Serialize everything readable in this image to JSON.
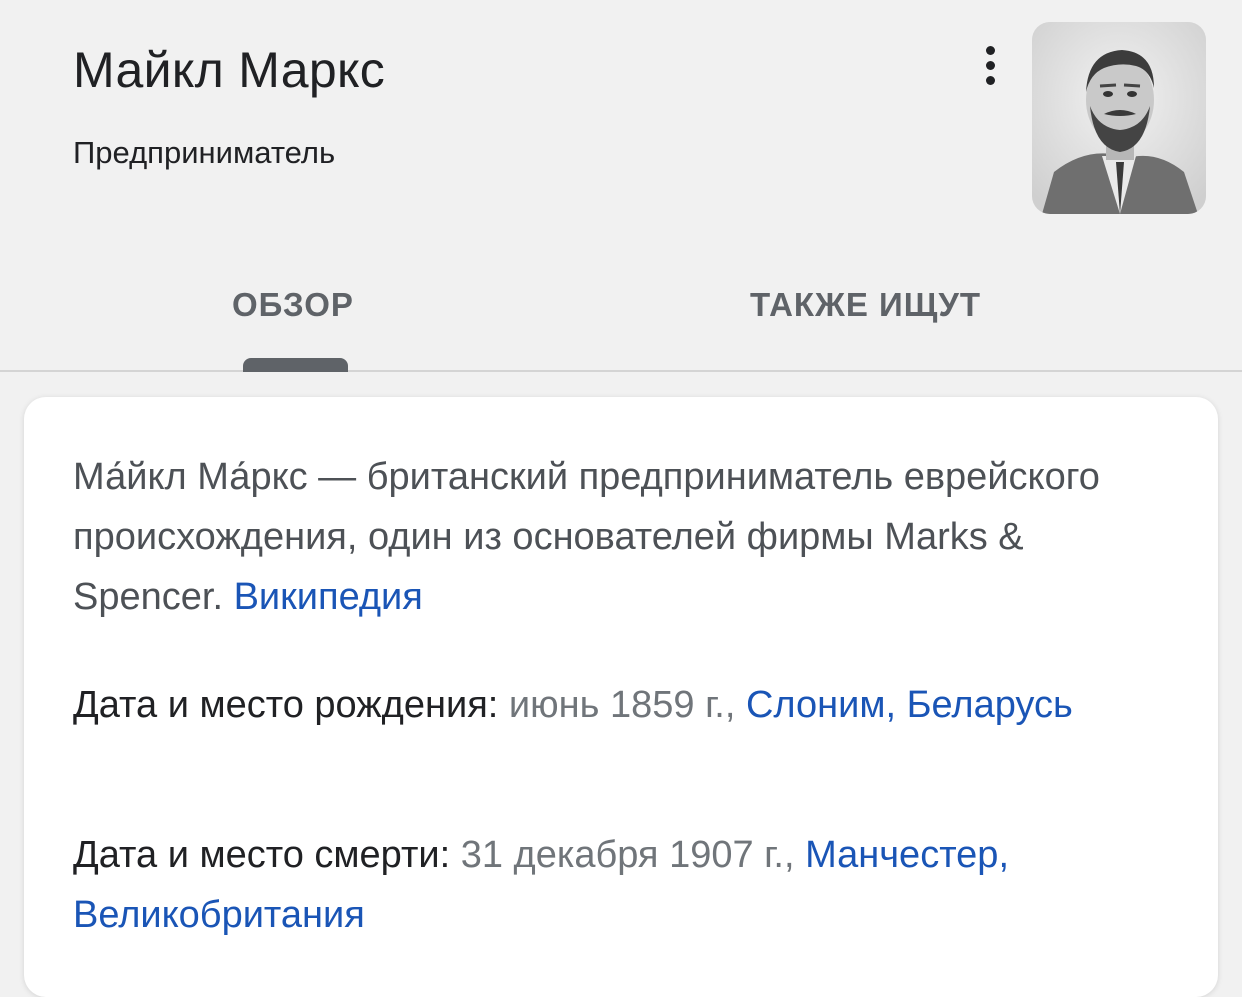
{
  "header": {
    "name": "Майкл Маркс",
    "subtitle": "Предприниматель",
    "menu_icon": "more-vert-icon",
    "photo_alt": "Майкл Маркс"
  },
  "tabs": [
    {
      "label": "ОБЗОР",
      "selected": true
    },
    {
      "label": "ТАКЖЕ ИЩУТ",
      "selected": false
    }
  ],
  "card": {
    "description": "Ма́йкл Ма́ркс — британский предприниматель еврейского происхождения, один из основателей фирмы Marks & Spencer.",
    "source_link": "Википедия",
    "facts": [
      {
        "label": "Дата и место рождения:",
        "value": "июнь 1859 г.,",
        "link": "Слоним, Беларусь"
      },
      {
        "label": "Дата и место смерти:",
        "value": "31 декабря 1907 г.,",
        "link": "Манчестер, Великобритания"
      }
    ]
  },
  "colors": {
    "background": "#f1f1f1",
    "link": "#1a55b6",
    "text": "#202124",
    "muted": "#70757a"
  }
}
